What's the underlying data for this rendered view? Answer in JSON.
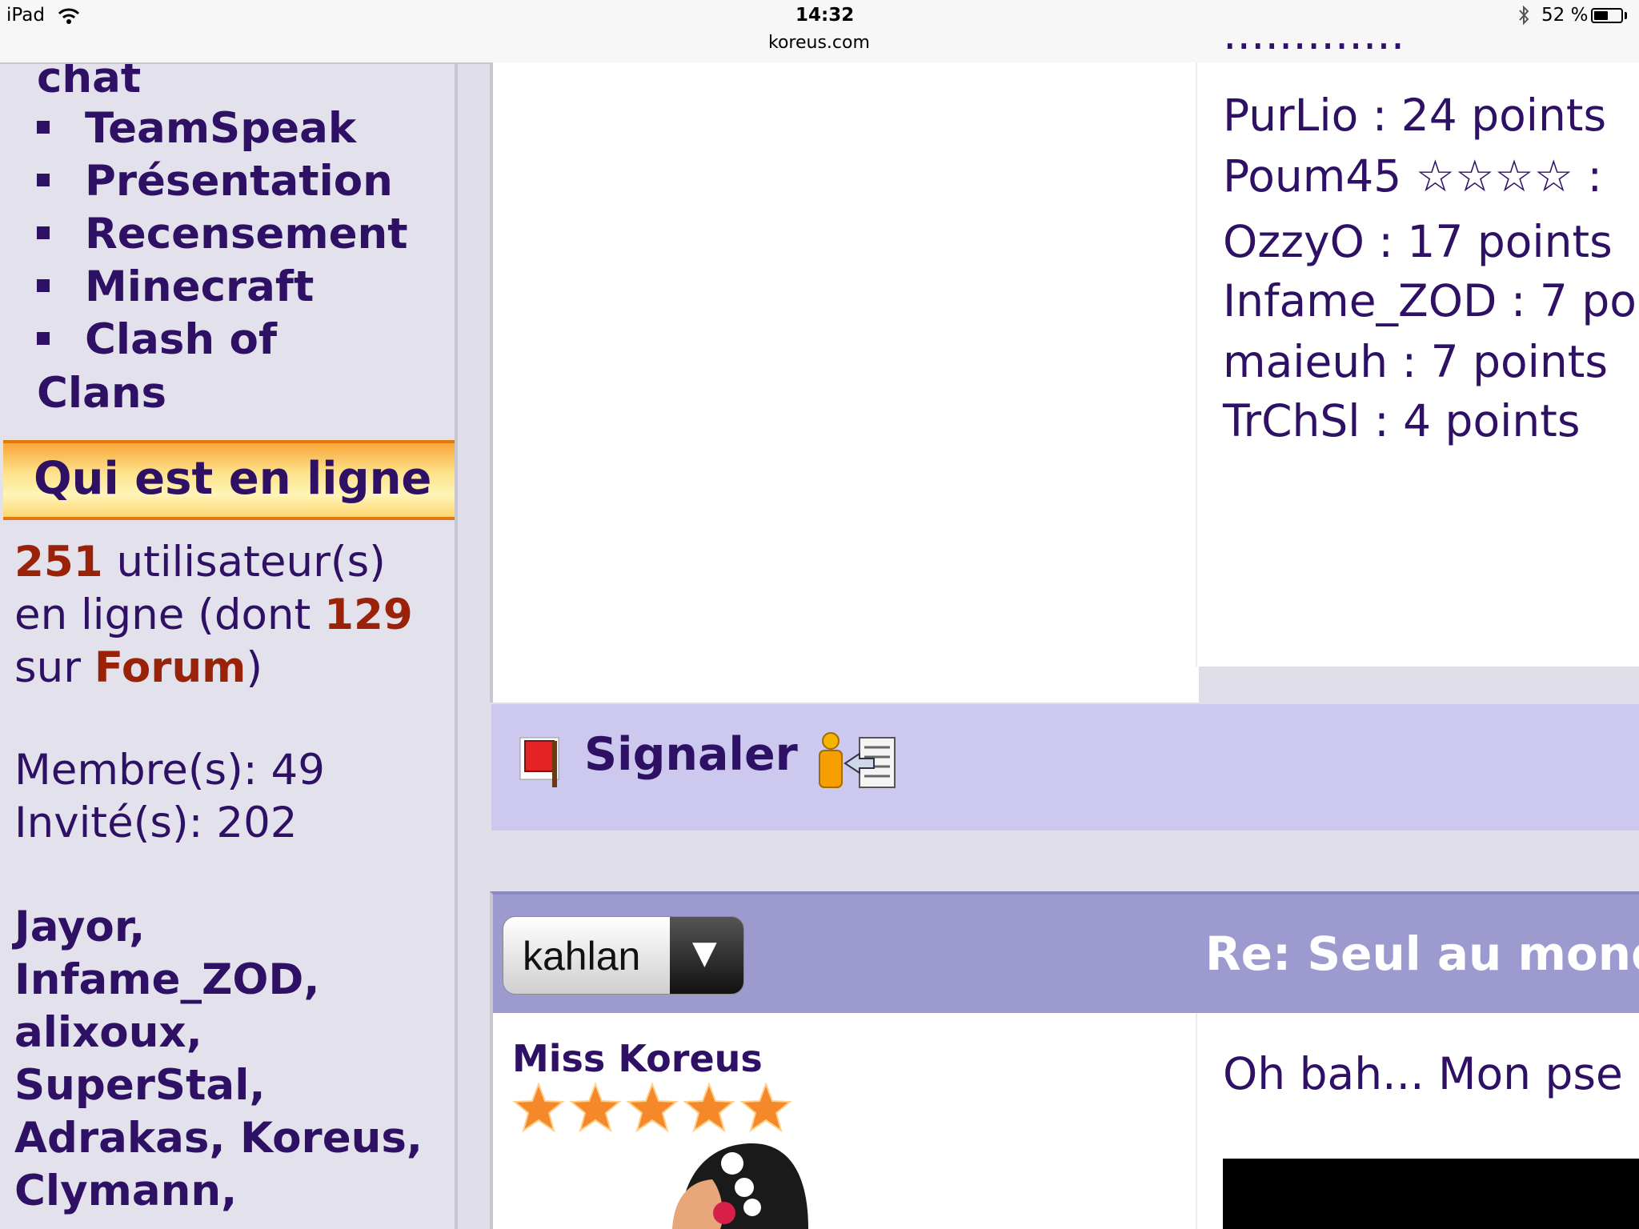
{
  "status_bar": {
    "device": "iPad",
    "time": "14:32",
    "url": "koreus.com",
    "battery": "52 %",
    "battery_level_pct": 52
  },
  "sidebar": {
    "menu_partial": "chat",
    "menu_items": [
      {
        "label": "TeamSpeak"
      },
      {
        "label": "Présentation"
      },
      {
        "label": "Recensement"
      },
      {
        "label": "Minecraft"
      },
      {
        "label": "Clash of"
      }
    ],
    "menu_continuation": "Clans",
    "online_title": "Qui est en ligne",
    "online": {
      "count": "251",
      "text1": " utilisateur(s)",
      "text2": "en ligne (dont ",
      "forum_count": "129",
      "text3": "sur ",
      "forum_label": "Forum",
      "text4": ")",
      "members": "Membre(s): 49",
      "guests": "Invité(s): 202"
    },
    "user_lines": [
      "Jayor,",
      "Infame_ZOD,",
      "alixoux,",
      "SuperStal,",
      "Adrakas, Koreus,",
      "Clymann,"
    ]
  },
  "scores": [
    "PurLio : 24 points",
    "Poum45 ☆☆☆☆ :",
    "OzzyO : 17 points",
    "Infame_ZOD : 7 po",
    "maieuh : 7 points",
    "TrChSl : 4 points"
  ],
  "post1": {
    "signal_label": "Signaler"
  },
  "post2": {
    "selected_user": "kahlan",
    "dropdown_arrow": "▼",
    "title": "Re: Seul au mond",
    "author": "Miss Koreus",
    "author_stars": 5,
    "text": "Oh bah... Mon pse"
  },
  "colors": {
    "text": "#2e1065",
    "accent_number": "#9a2208",
    "header_orange": "#f8a63a",
    "bar_lavender": "#ccc8ee",
    "post_header": "#9d9ad0"
  },
  "icons": [
    "wifi-icon",
    "bluetooth-icon",
    "battery-icon",
    "flag-icon",
    "report-icon",
    "star-icon",
    "avatar"
  ]
}
